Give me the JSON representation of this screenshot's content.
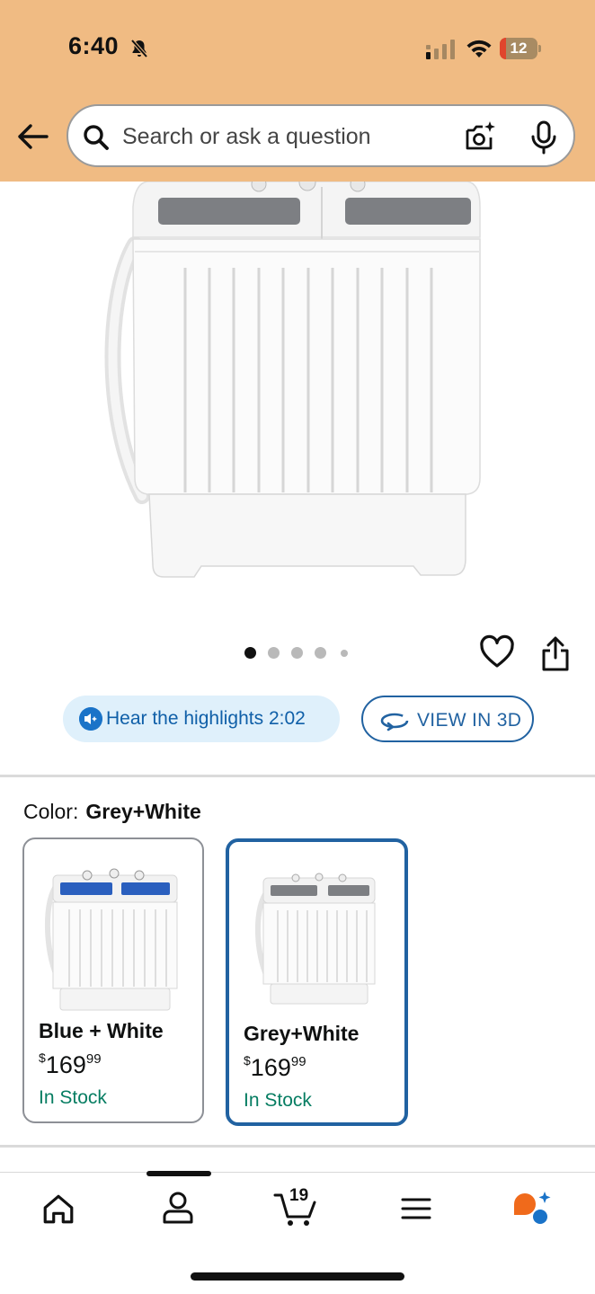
{
  "status_bar": {
    "time": "6:40",
    "battery": "12"
  },
  "header": {
    "search_placeholder": "Search or ask a question",
    "background_color": "#f0bb83"
  },
  "gallery": {
    "image_count": 5,
    "active_index": 0
  },
  "actions": {
    "hear_highlights": "Hear the highlights 2:02",
    "view_3d": "VIEW IN 3D"
  },
  "color_selector": {
    "label": "Color:",
    "selected": "Grey+White",
    "options": [
      {
        "name": "Blue + White",
        "currency": "$",
        "price_whole": "169",
        "price_cents": "99",
        "stock": "In Stock",
        "selected": false
      },
      {
        "name": "Grey+White",
        "currency": "$",
        "price_whole": "169",
        "price_cents": "99",
        "stock": "In Stock",
        "selected": true
      }
    ]
  },
  "bottom_nav": {
    "items": [
      "home-icon",
      "account-icon",
      "cart-icon",
      "menu-icon",
      "rufus-icon"
    ],
    "cart_count": "19"
  },
  "colors": {
    "accent_blue": "#2162a1",
    "in_stock_green": "#067d62"
  }
}
